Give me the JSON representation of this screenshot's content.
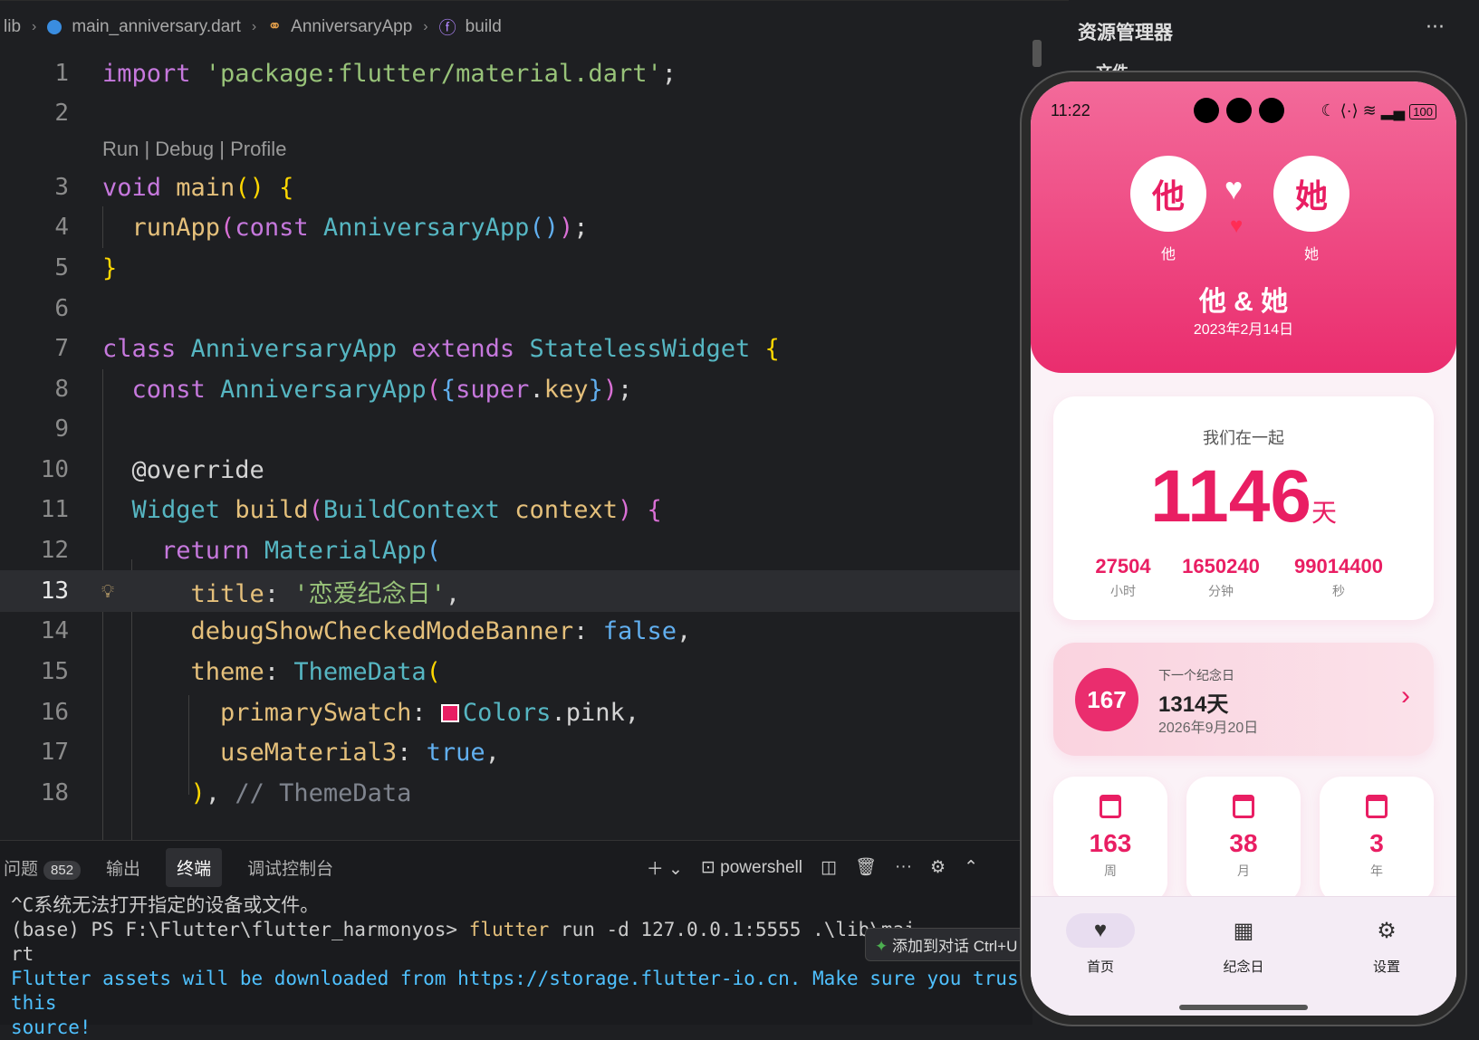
{
  "breadcrumb": {
    "root": "lib",
    "file": "main_anniversary.dart",
    "class": "AnniversaryApp",
    "method": "build"
  },
  "codelens": "Run | Debug | Profile",
  "code": {
    "l1": [
      [
        "kw",
        "import "
      ],
      [
        "str",
        "'package:flutter/material.dart'"
      ],
      [
        "plain",
        ";"
      ]
    ],
    "l3": [
      [
        "kw",
        "void "
      ],
      [
        "fn",
        "main"
      ],
      [
        "y",
        "() {"
      ]
    ],
    "l4": [
      [
        "fn",
        "  runApp"
      ],
      [
        "p",
        "("
      ],
      [
        "kw",
        "const "
      ],
      [
        "cls",
        "AnniversaryApp"
      ],
      [
        "bl",
        "()"
      ],
      [
        "p",
        ")"
      ],
      [
        "plain",
        ";"
      ]
    ],
    "l5": [
      [
        "y",
        "}"
      ]
    ],
    "l7": [
      [
        "kw",
        "class "
      ],
      [
        "cls",
        "AnniversaryApp "
      ],
      [
        "kw",
        "extends "
      ],
      [
        "cls",
        "StatelessWidget "
      ],
      [
        "y",
        "{"
      ]
    ],
    "l8": [
      [
        "kw",
        "  const "
      ],
      [
        "cls",
        "AnniversaryApp"
      ],
      [
        "p",
        "("
      ],
      [
        "bl",
        "{"
      ],
      [
        "kw",
        "super"
      ],
      [
        "plain",
        "."
      ],
      [
        "fn",
        "key"
      ],
      [
        "bl",
        "}"
      ],
      [
        "p",
        ")"
      ],
      [
        "plain",
        ";"
      ]
    ],
    "l10": [
      [
        "plain",
        "  @override"
      ]
    ],
    "l11": [
      [
        "cls",
        "  Widget "
      ],
      [
        "fn",
        "build"
      ],
      [
        "p",
        "("
      ],
      [
        "cls",
        "BuildContext "
      ],
      [
        "fn",
        "context"
      ],
      [
        "p",
        ") "
      ],
      [
        "p",
        "{"
      ]
    ],
    "l12": [
      [
        "kw",
        "    return "
      ],
      [
        "cls",
        "MaterialApp"
      ],
      [
        "bl",
        "("
      ]
    ],
    "l13": [
      [
        "prop",
        "      title"
      ],
      [
        "plain",
        ": "
      ],
      [
        "str",
        "'恋爱纪念日'"
      ],
      [
        "plain",
        ","
      ]
    ],
    "l14": [
      [
        "prop",
        "      debugShowCheckedModeBanner"
      ],
      [
        "plain",
        ": "
      ],
      [
        "bl",
        "false"
      ],
      [
        "plain",
        ","
      ]
    ],
    "l15": [
      [
        "prop",
        "      theme"
      ],
      [
        "plain",
        ": "
      ],
      [
        "cls",
        "ThemeData"
      ],
      [
        "y",
        "("
      ]
    ],
    "l16": [
      [
        "prop",
        "        primarySwatch"
      ],
      [
        "plain",
        ": "
      ],
      [
        "swatch",
        ""
      ],
      [
        "cls",
        "Colors"
      ],
      [
        "plain",
        ".pink,"
      ]
    ],
    "l17": [
      [
        "prop",
        "        useMaterial3"
      ],
      [
        "plain",
        ": "
      ],
      [
        "bl",
        "true"
      ],
      [
        "plain",
        ","
      ]
    ],
    "l18": [
      [
        "y",
        "      )"
      ],
      [
        "plain",
        ", "
      ],
      [
        "comment",
        "// ThemeData"
      ]
    ]
  },
  "panel": {
    "tabs": [
      "问题",
      "输出",
      "终端",
      "调试控制台"
    ],
    "problems_count": "852",
    "shell": "powershell"
  },
  "terminal": {
    "line1": "^C系统无法打开指定的设备或文件。",
    "prompt": "(base) PS F:\\Flutter\\flutter_harmonyos>",
    "cmd": "flutter",
    "args": "run -d 127.0.0.1:5555 .\\lib\\mai",
    "wrap": "rt",
    "info1": "Flutter assets will be downloaded from https://storage.flutter-io.cn. Make sure you trust this",
    "info2": "source!"
  },
  "chip": "添加到对话 Ctrl+U",
  "explorer": {
    "title": "资源管理器",
    "section": "文件"
  },
  "phone": {
    "time": "11:22",
    "battery": "100",
    "avatars": {
      "he": "他",
      "she": "她"
    },
    "couple": "他 & 她",
    "date": "2023年2月14日",
    "together_label": "我们在一起",
    "days": "1146",
    "days_unit": "天",
    "stats": [
      {
        "v": "27504",
        "u": "小时"
      },
      {
        "v": "1650240",
        "u": "分钟"
      },
      {
        "v": "99014400",
        "u": "秒"
      }
    ],
    "next": {
      "label": "下一个纪念日",
      "count": "167",
      "title": "1314天",
      "date": "2026年9月20日"
    },
    "mini": [
      {
        "v": "163",
        "u": "周"
      },
      {
        "v": "38",
        "u": "月"
      },
      {
        "v": "3",
        "u": "年"
      }
    ],
    "nav": [
      {
        "label": "首页"
      },
      {
        "label": "纪念日"
      },
      {
        "label": "设置"
      }
    ],
    "colors": {
      "accent": "#e91e63",
      "hero_top": "#f36a9a",
      "hero_bottom": "#ea2d6e"
    }
  }
}
